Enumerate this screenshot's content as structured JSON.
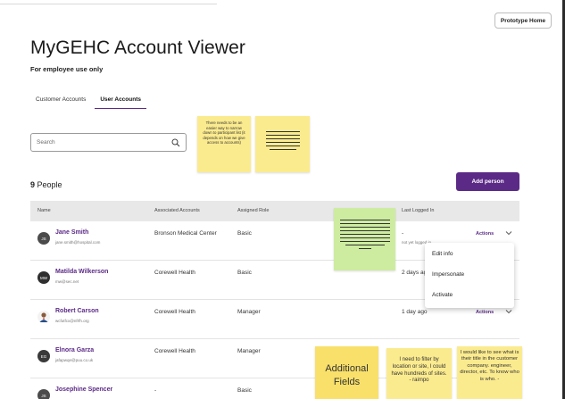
{
  "header": {
    "prototype_home_label": "Prototype Home",
    "title": "MyGEHC Account Viewer",
    "subtitle": "For employee use only"
  },
  "tabs": [
    {
      "label": "Customer Accounts",
      "active": false
    },
    {
      "label": "User Accounts",
      "active": true
    }
  ],
  "search": {
    "placeholder": "Search",
    "icon": "search-icon"
  },
  "summary": {
    "count": "9",
    "label": "People"
  },
  "add_person_label": "Add person",
  "table": {
    "headers": [
      "Name",
      "Associated Accounts",
      "Assigned Role",
      "Last Logged In"
    ],
    "rows": [
      {
        "initials": "JS",
        "name": "Jane Smith",
        "email": "jane.smith@hospital.com",
        "account": "Bronson Medical Center",
        "role": "Basic",
        "last_login": "-",
        "last_login_sub": "not yet logged in",
        "actions": "Actions"
      },
      {
        "initials": "MW",
        "name": "Matilda Wilkerson",
        "email": "mw@sec.net",
        "account": "Corewell Health",
        "role": "Basic",
        "last_login": "2 days ago",
        "last_login_sub": "",
        "actions": ""
      },
      {
        "initials": "",
        "name": "Robert Carson",
        "email": "wcfutfcx@nfrfh.org",
        "account": "Corewell Health",
        "role": "Manager",
        "last_login": "1 day ago",
        "last_login_sub": "",
        "actions": "Actions"
      },
      {
        "initials": "EG",
        "name": "Elnora Garza",
        "email": "jafapwqe@puu.co.uk",
        "account": "Corewell Health",
        "role": "Manager",
        "last_login": "",
        "last_login_sub": "",
        "actions": ""
      },
      {
        "initials": "JS",
        "name": "Josephine Spencer",
        "email": "",
        "account": "-",
        "role": "Basic",
        "last_login": "",
        "last_login_sub": "",
        "actions": ""
      }
    ]
  },
  "actions_menu": [
    "Edit info",
    "Impersonate",
    "Activate"
  ],
  "sticky_notes": {
    "filter_note": "There needs to be an easier way to narrow down to participant list (it depends on how we give access to accounts)",
    "additional_fields": "Additional Fields",
    "location_note": "I need to filter by location or site, I could have hundreds of sites. - raimpo",
    "title_note": "I would like to see what is their title in the customer company. engineer, director, etc. To know who is who. -"
  },
  "colors": {
    "accent": "#5b2a86",
    "sticky_yellow": "#fbeb8f",
    "sticky_green": "#cdeca0"
  }
}
